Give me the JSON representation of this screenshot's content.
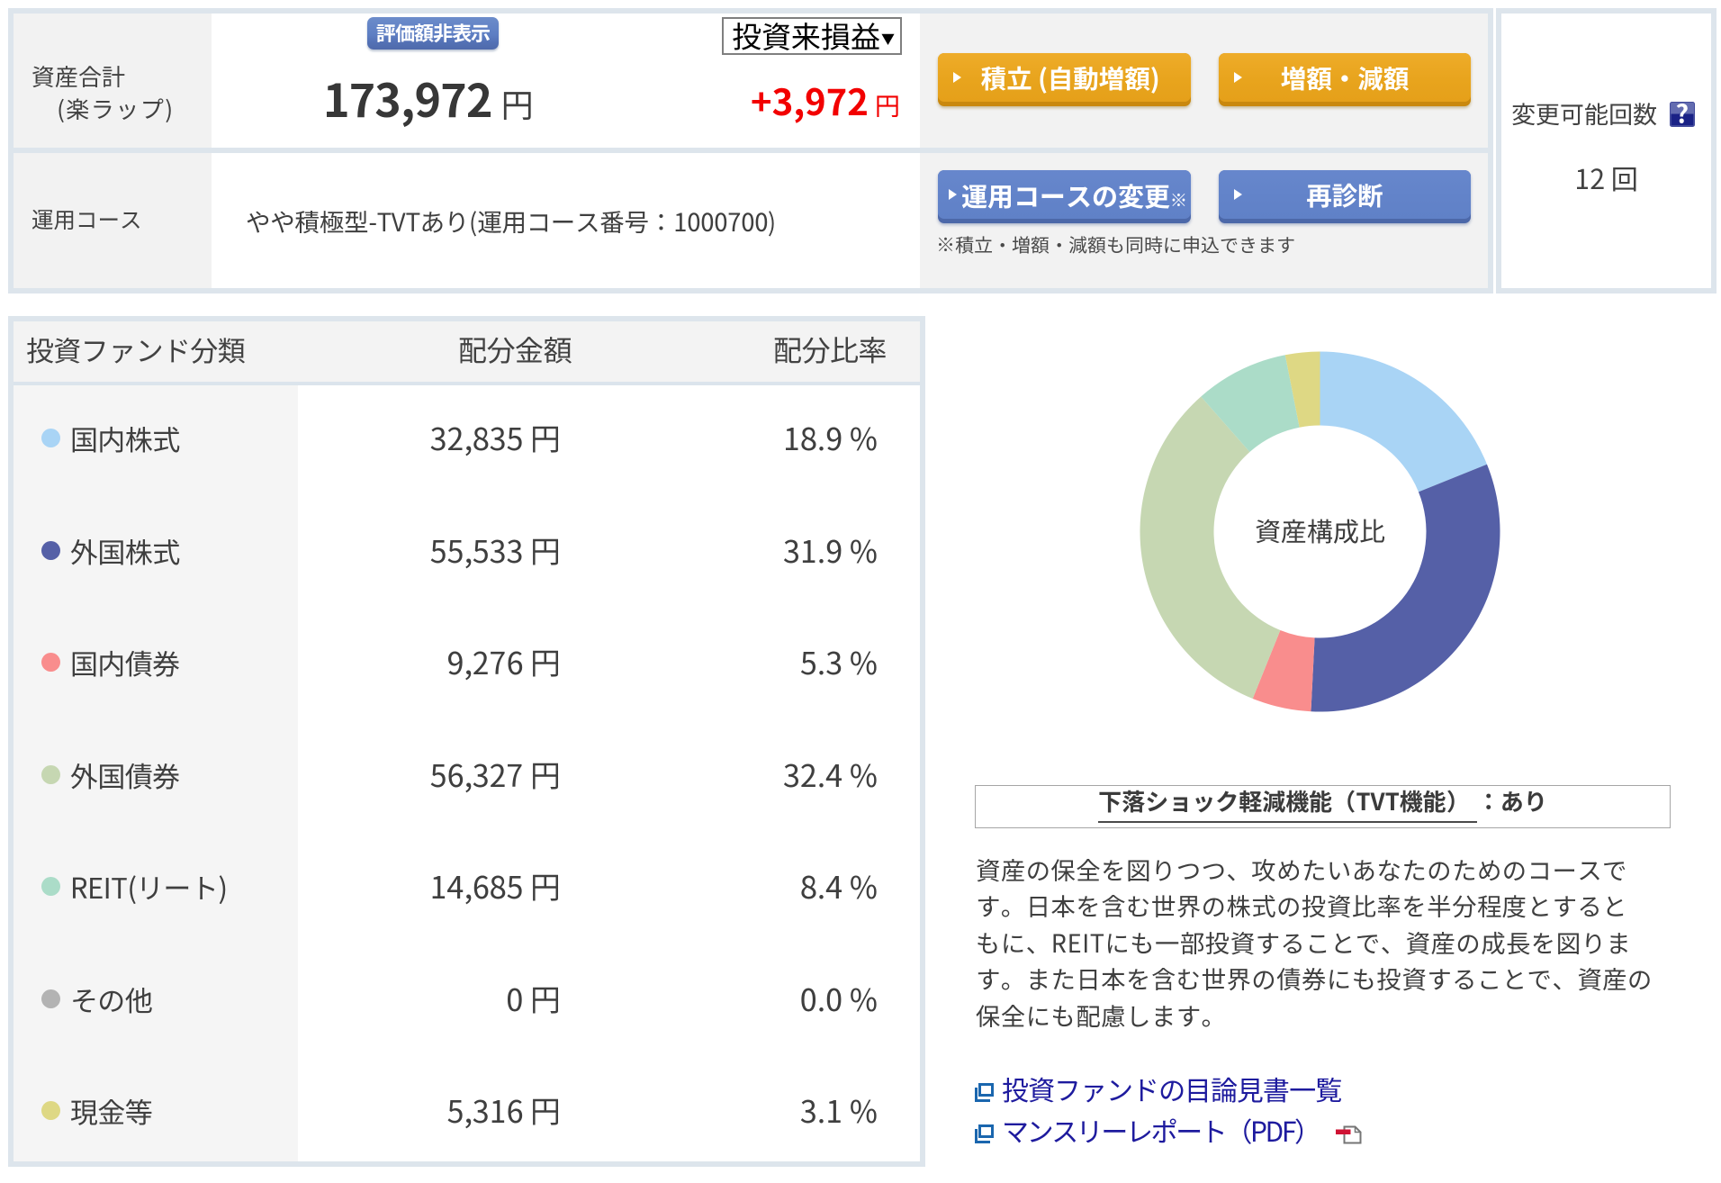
{
  "summary": {
    "total_label_line1": "資産合計",
    "total_label_line2": "(楽ラップ)",
    "hide_button": "評価額非表示",
    "total_amount": "173,972",
    "total_unit": "円",
    "period_select": {
      "value": "投資来損益",
      "arrow": "▼"
    },
    "gain_amount": "+3,972",
    "gain_unit": "円",
    "gain_color": "#f20000",
    "buttons": {
      "tsumitate": "積立 (自動増額)",
      "zougaku": "増額・減額",
      "course_change": "運用コースの変更",
      "course_change_mark": "※",
      "rediagnose": "再診断"
    },
    "course_label": "運用コース",
    "course_name": "やや積極型-TVTあり(運用コース番号：1000700)",
    "note": "※積立・増額・減額も同時に申込できます"
  },
  "changes_panel": {
    "label": "変更可能回数",
    "help_icon": "?",
    "count": "12 回"
  },
  "allocation": {
    "headers": {
      "category": "投資ファンド分類",
      "amount": "配分金額",
      "ratio": "配分比率"
    },
    "rows": [
      {
        "label": "国内株式",
        "amount": "32,835 円",
        "ratio": "18.9 %",
        "color": "#a9d4f5"
      },
      {
        "label": "外国株式",
        "amount": "55,533 円",
        "ratio": "31.9 %",
        "color": "#5560a7"
      },
      {
        "label": "国内債券",
        "amount": "9,276 円",
        "ratio": "5.3 %",
        "color": "#f98d8d"
      },
      {
        "label": "外国債券",
        "amount": "56,327 円",
        "ratio": "32.4 %",
        "color": "#c6d7b2"
      },
      {
        "label": "REIT(リート)",
        "amount": "14,685 円",
        "ratio": "8.4 %",
        "color": "#abdcc8"
      },
      {
        "label": "その他",
        "amount": "0 円",
        "ratio": "0.0 %",
        "color": "#b3b3b3"
      },
      {
        "label": "現金等",
        "amount": "5,316 円",
        "ratio": "3.1 %",
        "color": "#ded884"
      }
    ]
  },
  "chart_data": {
    "type": "pie",
    "title": "資産構成比",
    "categories": [
      "国内株式",
      "外国株式",
      "国内債券",
      "外国債券",
      "REIT(リート)",
      "その他",
      "現金等"
    ],
    "values": [
      18.9,
      31.9,
      5.3,
      32.4,
      8.4,
      0.0,
      3.1
    ],
    "colors": [
      "#a9d4f5",
      "#5560a7",
      "#f98d8d",
      "#c6d7b2",
      "#abdcc8",
      "#b3b3b3",
      "#ded884"
    ],
    "center_label": "資産構成比",
    "donut_outer_radius": 200,
    "donut_inner_radius": 118,
    "start_angle_deg": 0,
    "direction": "clockwise"
  },
  "tvt": {
    "underlined": "下落ショック軽減機能（TVT機能）",
    "rest": "：あり"
  },
  "description_lines": [
    "資産の保全を図りつつ、攻めたいあなたのためのコースで",
    "す。日本を含む世界の株式の投資比率を半分程度とすると",
    "もに、REITにも一部投資することで、資産の成長を図りま",
    "す。また日本を含む世界の債券にも投資することで、資産の",
    "保全にも配慮します。"
  ],
  "links": [
    {
      "label": "投資ファンドの目論見書一覧",
      "pdf": false
    },
    {
      "label": "マンスリーレポート（PDF）",
      "pdf": true
    }
  ]
}
